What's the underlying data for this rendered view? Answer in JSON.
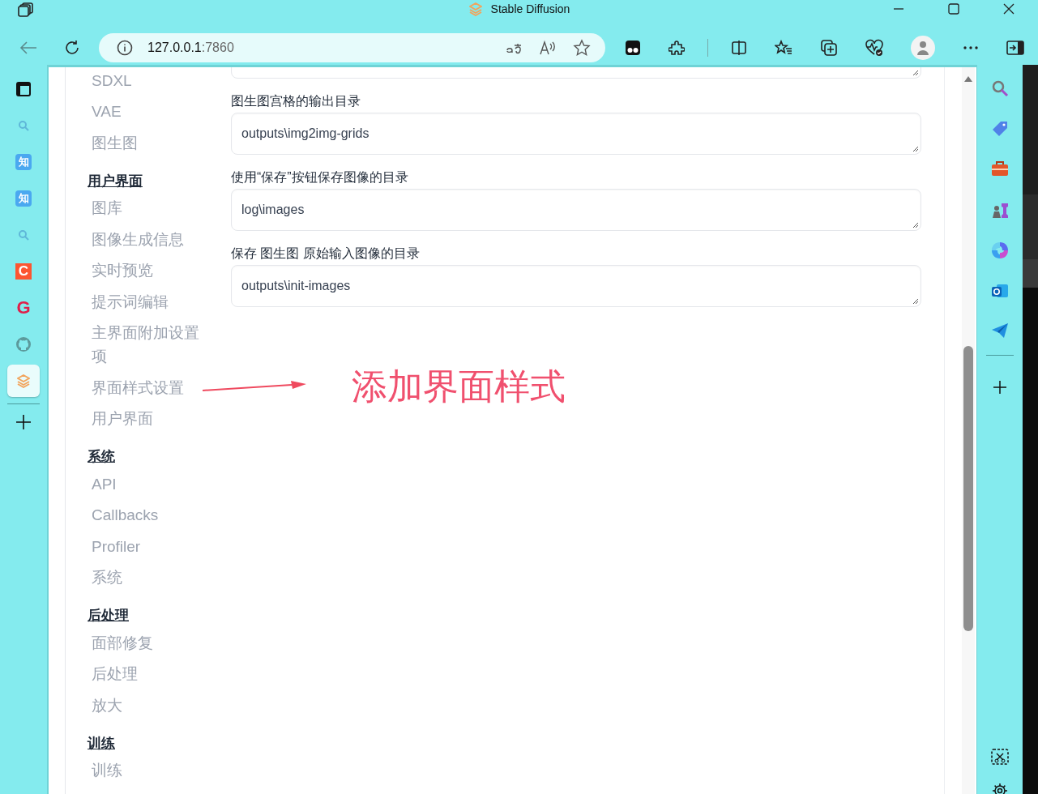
{
  "window": {
    "title": "Stable Diffusion"
  },
  "address_bar": {
    "host": "127.0.0.1",
    "port": ":7860"
  },
  "left_rail": [
    {
      "kind": "workspace",
      "selected": false
    },
    {
      "kind": "search",
      "selected": false
    },
    {
      "kind": "zhihu",
      "glyph": "知",
      "selected": false
    },
    {
      "kind": "zhihu",
      "glyph": "知",
      "selected": false
    },
    {
      "kind": "search",
      "selected": false
    },
    {
      "kind": "csdn",
      "glyph": "C",
      "selected": false
    },
    {
      "kind": "g",
      "glyph": "G",
      "selected": false
    },
    {
      "kind": "github",
      "selected": false
    },
    {
      "kind": "sd",
      "selected": true
    }
  ],
  "settings_nav": [
    {
      "kind": "item",
      "label": "SDXL"
    },
    {
      "kind": "item",
      "label": "VAE"
    },
    {
      "kind": "item",
      "label": "图生图"
    },
    {
      "kind": "heading",
      "label": "用户界面"
    },
    {
      "kind": "item",
      "label": "图库"
    },
    {
      "kind": "item",
      "label": "图像生成信息"
    },
    {
      "kind": "item",
      "label": "实时预览"
    },
    {
      "kind": "item",
      "label": "提示词编辑"
    },
    {
      "kind": "item",
      "label": "主界面附加设置项"
    },
    {
      "kind": "item",
      "label": "界面样式设置"
    },
    {
      "kind": "item",
      "label": "用户界面"
    },
    {
      "kind": "heading",
      "label": "系统"
    },
    {
      "kind": "item",
      "label": "API"
    },
    {
      "kind": "item",
      "label": "Callbacks"
    },
    {
      "kind": "item",
      "label": "Profiler"
    },
    {
      "kind": "item",
      "label": "系统"
    },
    {
      "kind": "heading",
      "label": "后处理"
    },
    {
      "kind": "item",
      "label": "面部修复"
    },
    {
      "kind": "item",
      "label": "后处理"
    },
    {
      "kind": "item",
      "label": "放大"
    },
    {
      "kind": "heading",
      "label": "训练"
    },
    {
      "kind": "item",
      "label": "训练"
    }
  ],
  "fields": [
    {
      "label": "图生图宫格的输出目录",
      "value": "outputs\\img2img-grids"
    },
    {
      "label": "使用“保存”按钮保存图像的目录",
      "value": "log\\images"
    },
    {
      "label": "保存 图生图 原始输入图像的目录",
      "value": "outputs\\init-images"
    }
  ],
  "annotation": {
    "text": "添加界面样式"
  }
}
